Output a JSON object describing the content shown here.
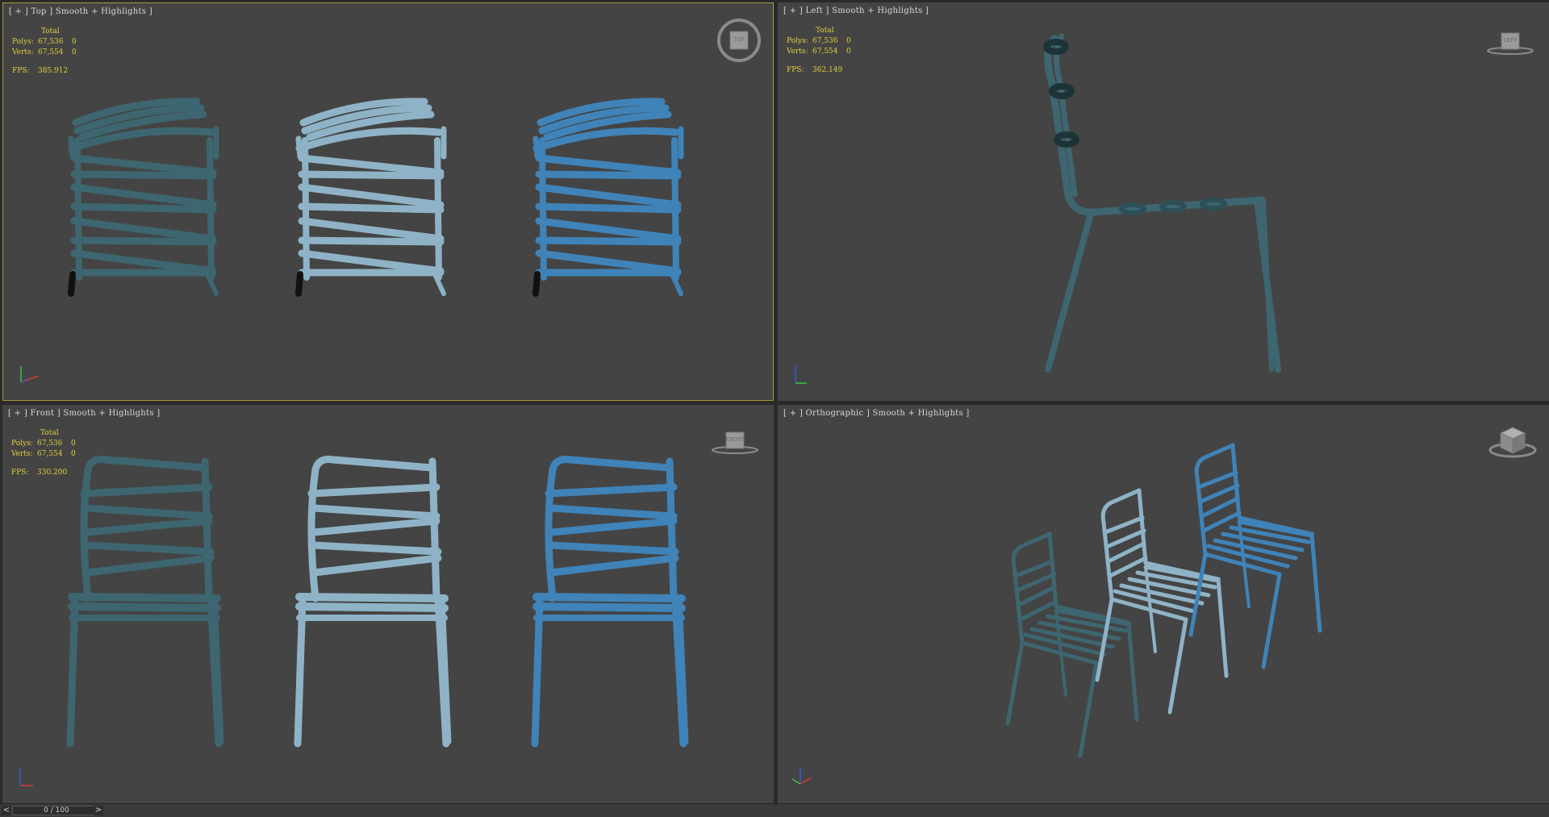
{
  "viewports": {
    "top": {
      "label": "[ + ] Top ] Smooth + Highlights ]",
      "stats_header": "Total",
      "polys_label": "Polys:",
      "polys_value": "67,536",
      "polys_sel": "0",
      "verts_label": "Verts:",
      "verts_value": "67,554",
      "verts_sel": "0",
      "fps_label": "FPS:",
      "fps_value": "385.912",
      "viewcube_label": "TOP"
    },
    "left": {
      "label": "[ + ] Left ] Smooth + Highlights ]",
      "stats_header": "Total",
      "polys_label": "Polys:",
      "polys_value": "67,536",
      "polys_sel": "0",
      "verts_label": "Verts:",
      "verts_value": "67,554",
      "verts_sel": "0",
      "fps_label": "FPS:",
      "fps_value": "362.149",
      "viewcube_label": "LEFT"
    },
    "front": {
      "label": "[ + ] Front ] Smooth + Highlights ]",
      "stats_header": "Total",
      "polys_label": "Polys:",
      "polys_value": "67,536",
      "polys_sel": "0",
      "verts_label": "Verts:",
      "verts_value": "67,554",
      "verts_sel": "0",
      "fps_label": "FPS:",
      "fps_value": "330.200",
      "viewcube_label": "FRONT"
    },
    "perspective": {
      "label": "[ + ] Orthographic ] Smooth + Highlights ]"
    }
  },
  "colors": {
    "chair_dark": "#3d6670",
    "chair_light": "#8fb3c6",
    "chair_blue": "#3f83b8",
    "viewport_bg": "#444444",
    "active_border": "#a89a3a",
    "stats_text": "#e2cf3a"
  },
  "timeline": {
    "prev_label": "<",
    "next_label": ">",
    "frame_text": "0 / 100"
  }
}
